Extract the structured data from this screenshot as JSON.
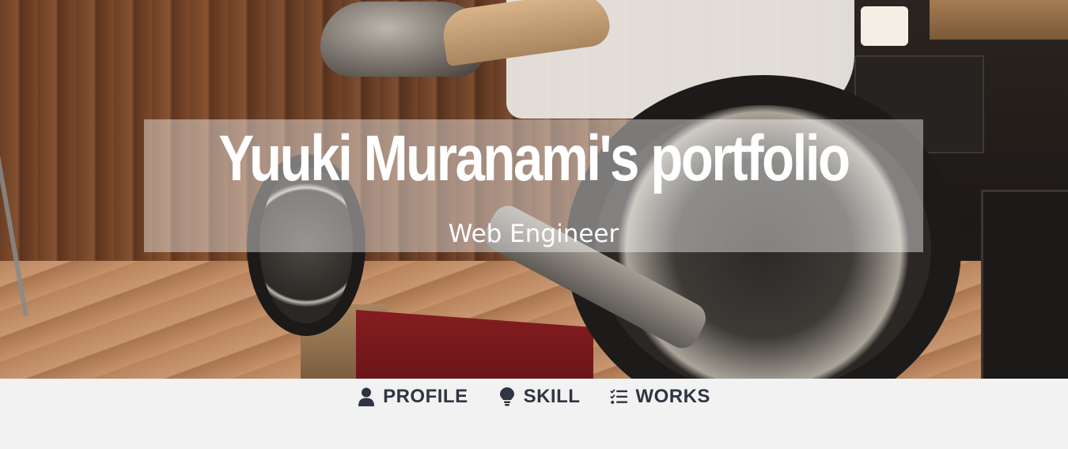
{
  "header": {
    "title": "Yuuki Muranami's portfolio",
    "subtitle": "Web Engineer"
  },
  "nav": {
    "items": [
      {
        "label": "PROFILE",
        "icon": "user-icon"
      },
      {
        "label": "SKILL",
        "icon": "lightbulb-icon"
      },
      {
        "label": "WORKS",
        "icon": "tasks-list-icon"
      }
    ]
  },
  "colors": {
    "nav_text": "#2f3542",
    "nav_background": "#f2f2f2",
    "title_text": "#ffffff"
  }
}
